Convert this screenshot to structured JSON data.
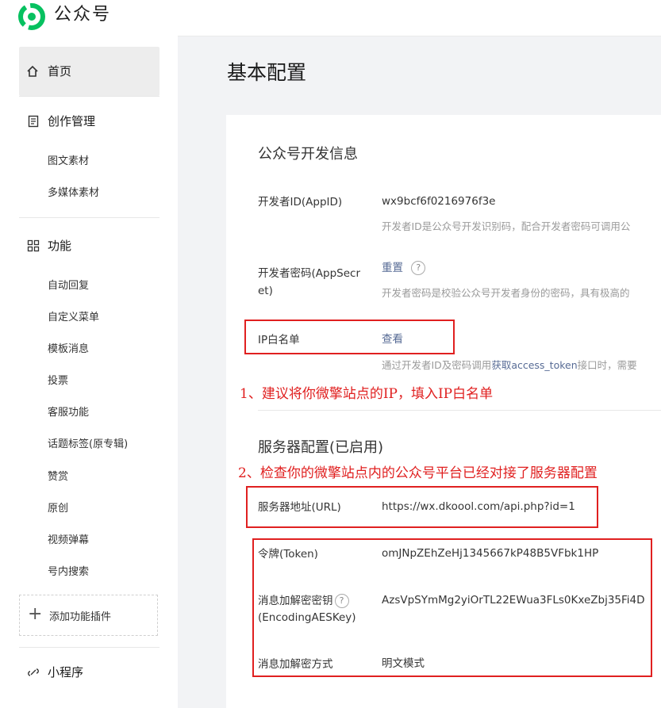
{
  "header": {
    "brand": "公众号"
  },
  "sidebar": {
    "home": "首页",
    "creation": {
      "label": "创作管理",
      "items": [
        "图文素材",
        "多媒体素材"
      ]
    },
    "features": {
      "label": "功能",
      "items": [
        "自动回复",
        "自定义菜单",
        "模板消息",
        "投票",
        "客服功能",
        "话题标签(原专辑)",
        "赞赏",
        "原创",
        "视频弹幕",
        "号内搜索"
      ]
    },
    "add_plugin": "添加功能插件",
    "miniprogram": "小程序"
  },
  "page": {
    "title": "基本配置"
  },
  "dev_info": {
    "title": "公众号开发信息",
    "appid_label": "开发者ID(AppID)",
    "appid_value": "wx9bcf6f0216976f3e",
    "appid_hint": "开发者ID是公众号开发识别码，配合开发者密码可调用公",
    "secret_label": "开发者密码(AppSecret)",
    "secret_action": "重置",
    "secret_hint": "开发者密码是校验公众号开发者身份的密码，具有极高的",
    "ip_label": "IP白名单",
    "ip_action": "查看",
    "ip_hint_pre": "通过开发者ID及密码调用",
    "ip_hint_link": "获取access_token",
    "ip_hint_post": "接口时，需要"
  },
  "server": {
    "title": "服务器配置(已启用)",
    "url_label": "服务器地址(URL)",
    "url_value": "https://wx.dkoool.com/api.php?id=1",
    "token_label": "令牌(Token)",
    "token_value": "omJNpZEhZeHj1345667kP48B5VFbk1HP",
    "aes_label_1": "消息加解密密钥",
    "aes_label_2": "(EncodingAESKey)",
    "aes_value": "AzsVpSYmMg2yiOrTL22EWua3FLs0KxeZbj35Fi4D",
    "mode_label": "消息加解密方式",
    "mode_value": "明文模式"
  },
  "annotations": {
    "note1": "1、建议将你微擎站点的IP，填入IP白名单",
    "note2": "2、检查你的微擎站点内的公众号平台已经对接了服务器配置"
  },
  "colors": {
    "accent_red": "#e02020",
    "link": "#576b95",
    "brand_green": "#07c160"
  }
}
